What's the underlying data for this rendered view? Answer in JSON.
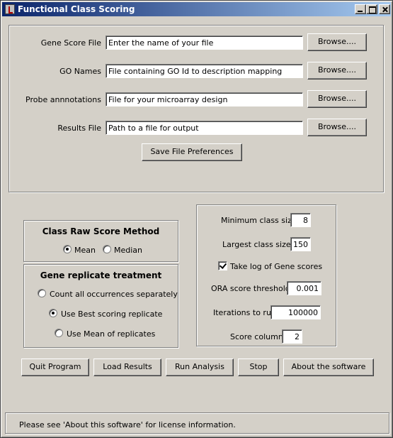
{
  "window": {
    "title": "Functional Class Scoring"
  },
  "files": {
    "gene_score": {
      "label": "Gene Score File",
      "value": "Enter the name of your file",
      "button": "Browse...."
    },
    "go_names": {
      "label": "GO Names",
      "value": "File containing GO Id to description mapping",
      "button": "Browse...."
    },
    "probe": {
      "label": "Probe annnotations",
      "value": "File for your microarray design",
      "button": "Browse...."
    },
    "results": {
      "label": "Results File",
      "value": "Path to a file for output",
      "button": "Browse...."
    },
    "save_prefs": "Save File Preferences"
  },
  "raw_score": {
    "title": "Class Raw Score Method",
    "options": [
      "Mean",
      "Median"
    ],
    "selected": "Mean"
  },
  "replicate": {
    "title": "Gene replicate treatment",
    "options": [
      "Count all occurrences separately",
      "Use Best scoring replicate",
      "Use Mean of replicates"
    ],
    "selected": "Use Best scoring replicate"
  },
  "params": {
    "min_class": {
      "label": "Minimum class size",
      "value": "8"
    },
    "max_class": {
      "label": "Largest class size",
      "value": "150"
    },
    "take_log": {
      "label": "Take log of Gene scores",
      "checked": true
    },
    "ora": {
      "label": "ORA score threshold",
      "value": "0.001"
    },
    "iterations": {
      "label": "Iterations to run",
      "value": "100000"
    },
    "score_col": {
      "label": "Score column",
      "value": "2"
    }
  },
  "actions": {
    "quit": "Quit Program",
    "load": "Load Results",
    "run": "Run Analysis",
    "stop": "Stop",
    "about": "About the software"
  },
  "status": "Please see 'About this software' for license information."
}
